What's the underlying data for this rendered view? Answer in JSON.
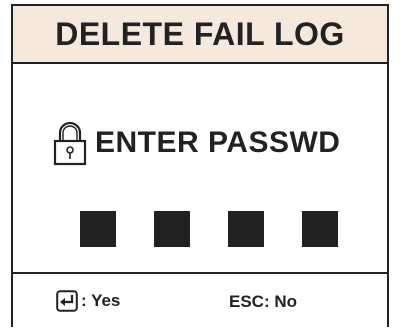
{
  "dialog": {
    "title": "DELETE FAIL LOG",
    "prompt_icon": "lock-icon",
    "prompt": "ENTER PASSWD",
    "password_digits_entered": 4,
    "footer": {
      "confirm_icon": "enter-key-icon",
      "confirm_label": ": Yes",
      "cancel_label": "ESC: No"
    }
  },
  "colors": {
    "header_background": "#f5e8dc",
    "foreground": "#222222",
    "background": "#ffffff"
  }
}
